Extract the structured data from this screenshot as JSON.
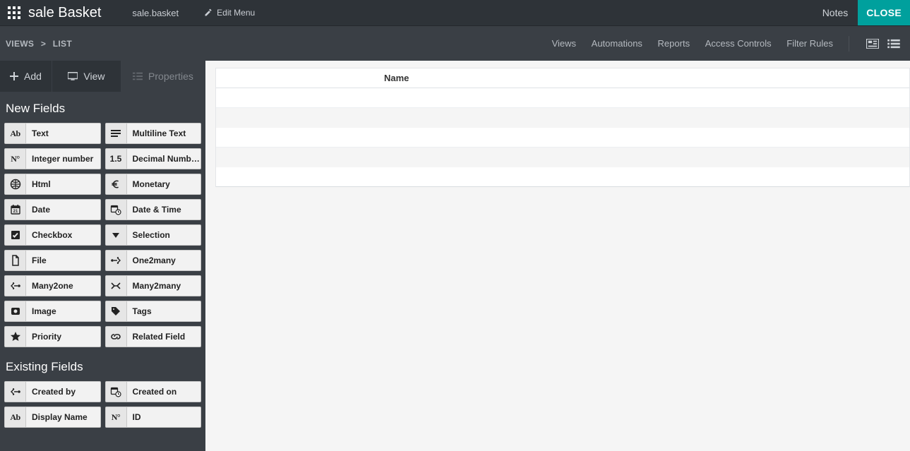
{
  "topbar": {
    "app_title": "sale Basket",
    "technical_name": "sale.basket",
    "edit_menu_label": "Edit Menu",
    "notes_label": "Notes",
    "close_label": "CLOSE"
  },
  "breadcrumb": {
    "root": "VIEWS",
    "current": "LIST"
  },
  "header_links": {
    "views": "Views",
    "automations": "Automations",
    "reports": "Reports",
    "access": "Access Controls",
    "filters": "Filter Rules"
  },
  "side_tabs": {
    "add": "Add",
    "view": "View",
    "properties": "Properties"
  },
  "sections": {
    "new_fields_title": "New Fields",
    "existing_fields_title": "Existing Fields"
  },
  "new_fields": {
    "text": "Text",
    "multiline": "Multiline Text",
    "integer": "Integer number",
    "decimal": "Decimal Numb…",
    "html": "Html",
    "monetary": "Monetary",
    "date": "Date",
    "datetime": "Date & Time",
    "checkbox": "Checkbox",
    "selection": "Selection",
    "file": "File",
    "one2many": "One2many",
    "many2one": "Many2one",
    "many2many": "Many2many",
    "image": "Image",
    "tags": "Tags",
    "priority": "Priority",
    "related": "Related Field"
  },
  "existing_fields": {
    "created_by": "Created by",
    "created_on": "Created on",
    "display_name": "Display Name",
    "id": "ID"
  },
  "list": {
    "columns": {
      "name": "Name"
    }
  },
  "icon_labels": {
    "integer": "N°",
    "decimal": "1.5",
    "text": "Ab",
    "id": "N°"
  }
}
